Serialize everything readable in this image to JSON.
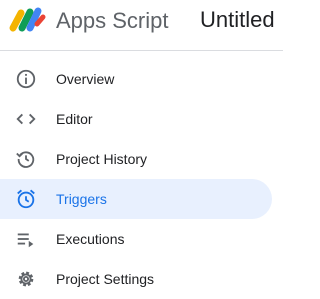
{
  "header": {
    "app_name": "Apps Script",
    "file_title": "Untitled"
  },
  "sidebar": {
    "items": [
      {
        "label": "Overview",
        "icon": "info-icon",
        "active": false
      },
      {
        "label": "Editor",
        "icon": "code-icon",
        "active": false
      },
      {
        "label": "Project History",
        "icon": "history-icon",
        "active": false
      },
      {
        "label": "Triggers",
        "icon": "alarm-clock-icon",
        "active": true
      },
      {
        "label": "Executions",
        "icon": "playlist-play-icon",
        "active": false
      },
      {
        "label": "Project Settings",
        "icon": "gear-icon",
        "active": false
      }
    ]
  },
  "colors": {
    "accent": "#1a73e8",
    "active_bg": "#e8f0fe",
    "icon": "#5f6368",
    "text": "#202124"
  }
}
